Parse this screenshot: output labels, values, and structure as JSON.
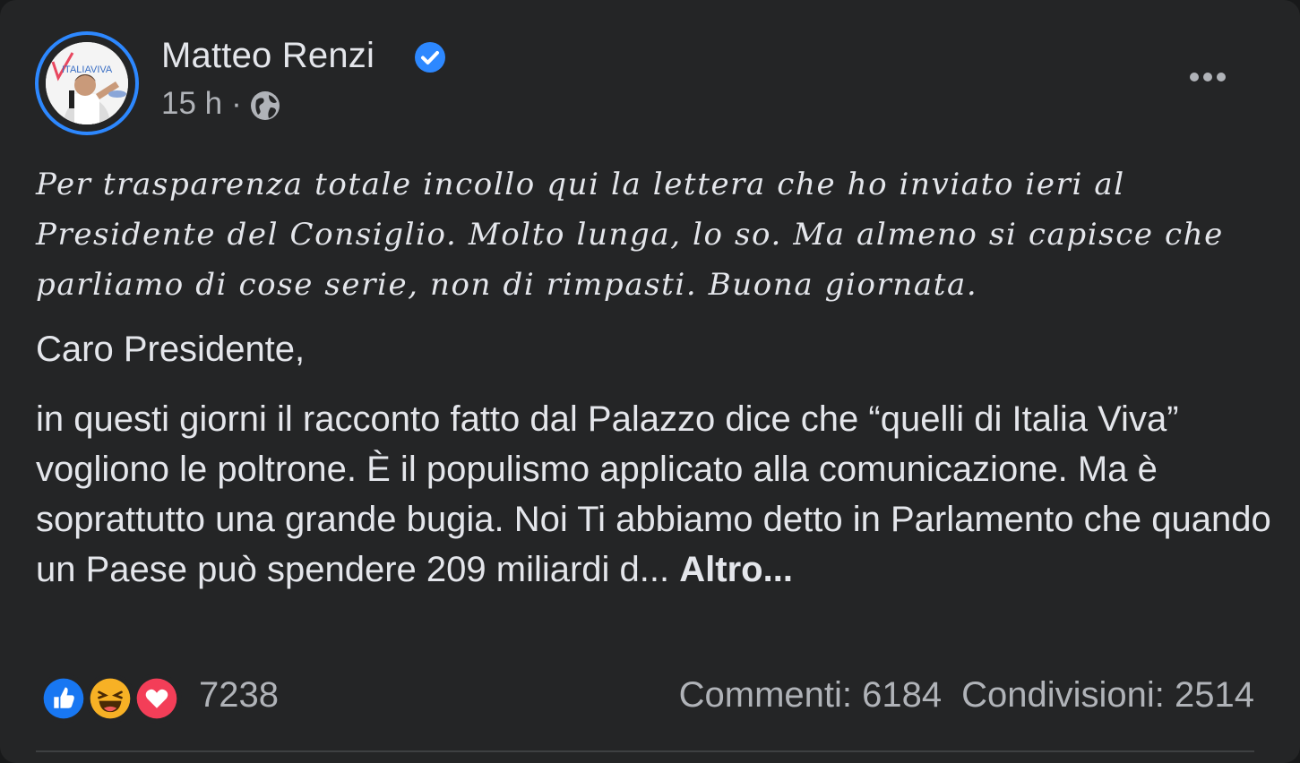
{
  "post": {
    "author": "Matteo Renzi",
    "verified": true,
    "timestamp": "15 h",
    "separator": "·",
    "audience_icon": "globe-icon",
    "intro": "Per trasparenza totale incollo qui la lettera che ho inviato ieri al Presidente del Consiglio. Molto lunga, lo so. Ma almeno si capisce che parliamo di cose serie, non di rimpasti. Buona giornata.",
    "greeting": "Caro Presidente,",
    "body": "in questi giorni il racconto fatto dal Palazzo dice che “quelli di Italia Viva” vogliono le poltrone. È il populismo applicato alla comunicazione. Ma è soprattutto una grande bugia. Noi Ti abbiamo detto in Parlamento che quando un Paese può spendere 209 miliardi d...",
    "see_more": "Altro...",
    "avatar_logo_text": "ITALIAVIVA"
  },
  "reactions": {
    "types": [
      "like",
      "haha",
      "love"
    ],
    "count": "7238"
  },
  "stats": {
    "comments": "Commenti: 6184",
    "shares": "Condivisioni: 2514"
  },
  "colors": {
    "background": "#242526",
    "text_primary": "#e4e6eb",
    "text_secondary": "#b0b3b8",
    "accent_blue": "#2d88ff",
    "like": "#1877f2",
    "haha": "#f7b125",
    "love": "#f33e58"
  }
}
